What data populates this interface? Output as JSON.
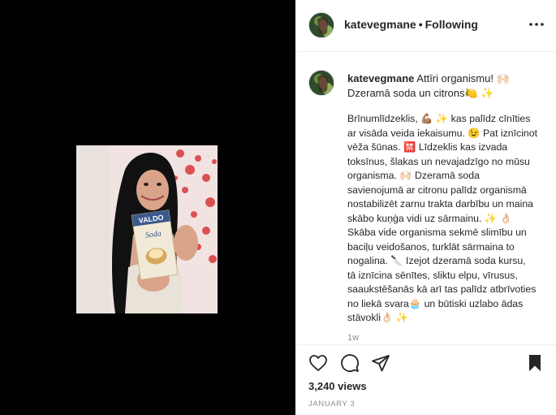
{
  "header": {
    "username": "katevegmane",
    "dot": "•",
    "follow_status": "Following",
    "more_label": "•••"
  },
  "caption": {
    "username": "katevegmane",
    "headline_rest": "Attīri organismu! 🙌🏻 Dzeramā soda un citrons🍋 ✨",
    "lines": [
      "Brīnumlīdzeklis, 💪🏽 ✨ kas palīdz cīnīties",
      "ar visāda veida iekaisumu. 😉 Pat iznīcinot",
      "vēža šūnas. 🈲 Līdzeklis kas izvada",
      "toksīnus, šlakas un nevajadzīgo no mūsu",
      "organisma. 🙌🏻 Dzeramā soda",
      "savienojumā ar citronu palīdz organismā",
      "nostabilizēt zarnu trakta darbību un maina",
      "skābo kuņģa vidi uz sārmainu. ✨ 👌🏻",
      "Skāba vide organisma sekmē slimību un",
      "baciļu veidošanos, turklāt sārmaina to",
      "nogalina. 🔪  Izejot dzeramā soda kursu,",
      "tā iznīcina sēnītes, sliktu elpu, vīrusus,",
      "saaukstēšanās kā arī tas palīdz atbrīvoties",
      "no liekā svara🧁  un būtiski uzlabo ādas",
      "stāvokli👌🏻 ✨"
    ],
    "time_ago": "1w"
  },
  "stats": {
    "views": "3,240 views",
    "date": "JANUARY 3"
  },
  "product": {
    "brand": "VALDO",
    "name": "Soda"
  },
  "colors": {
    "media_bg": "#000000",
    "text": "#262626",
    "muted": "#8e8e8e",
    "divider": "#efefef"
  },
  "icons": {
    "like": "heart-icon",
    "comment": "comment-icon",
    "share": "paper-plane-icon",
    "save": "bookmark-icon",
    "more": "ellipsis-icon"
  }
}
